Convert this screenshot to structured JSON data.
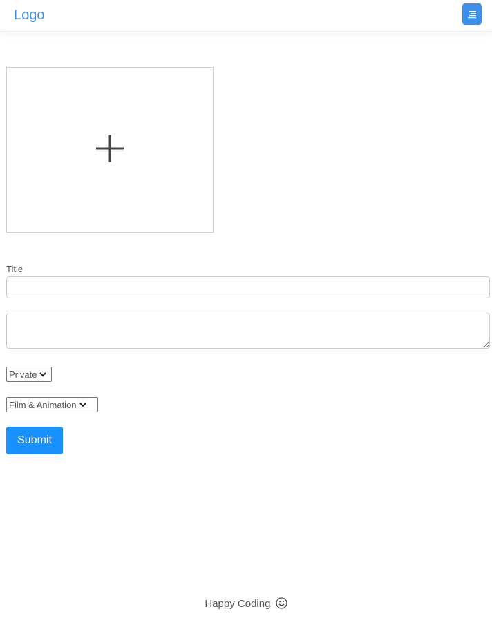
{
  "navbar": {
    "logo": "Logo",
    "menu_icon": "menu-icon",
    "accent_color": "#3d8fec"
  },
  "upload": {
    "icon": "plus-icon"
  },
  "form": {
    "title_label": "Title",
    "title_value": "",
    "description_value": "",
    "privacy_selected": "Private",
    "category_selected": "Film & Animation",
    "submit_label": "Submit",
    "submit_color": "#1890ff"
  },
  "footer": {
    "text": "Happy Coding",
    "icon": "smile-icon"
  }
}
